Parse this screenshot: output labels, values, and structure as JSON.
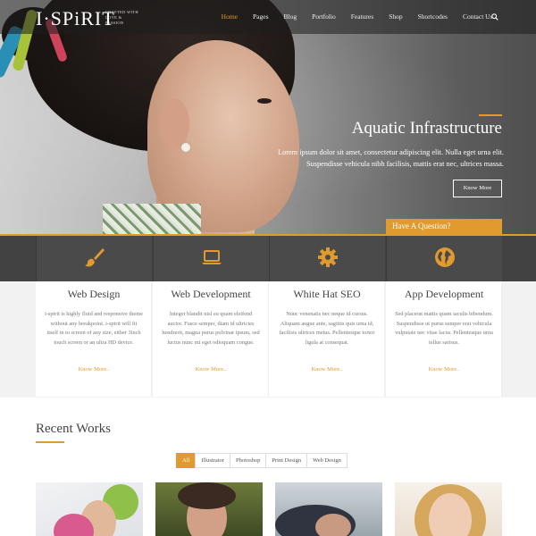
{
  "brand": {
    "logo_text": "I·SPiRIT",
    "tagline": "CRAFTED WITH LOVE & PASSION",
    "accent_color": "#e09a2e"
  },
  "nav": {
    "items": [
      "Home",
      "Pages",
      "Blog",
      "Portfolio",
      "Features",
      "Shop",
      "Shortcodes",
      "Contact Us"
    ],
    "active": "Home",
    "search_icon": "search-icon"
  },
  "hero": {
    "title": "Aquatic Infrastructure",
    "description": "Lorem ipsum dolor sit amet, consectetur adipiscing elit. Nulla eget urna elit. Suspendisse vehicula nibh facilisis, mattis erat nec, ultrices massa.",
    "button_label": "Know More"
  },
  "question_tab": {
    "label": "Have A Question?"
  },
  "services": [
    {
      "icon": "paintbrush-icon",
      "title": "Web Design",
      "description": "i-spirit is highly fluid and responsive theme without any breakpoint. i-spirit will fit itself in to screen of any size, either 3inch touch screen or an ultra HD device.",
      "link": "Know More.."
    },
    {
      "icon": "laptop-icon",
      "title": "Web Development",
      "description": "Integer blandit nisl eu quam eleifend auctor. Fusce semper, diam id ultricies hendrerit, magna purus pulvinar ipsum, sed luctus nunc mi eget odioquam congue.",
      "link": "Know More.."
    },
    {
      "icon": "gear-icon",
      "title": "White Hat SEO",
      "description": "Nunc venenatis nec neque id cursus. Aliquam augue ante, sagittis quis urna id, facilisis ultrices metus. Pellentesque tortor ligula at consequat.",
      "link": "Know More.."
    },
    {
      "icon": "globe-icon",
      "title": "App Development",
      "description": "Sed placerat mattis quam iaculis bibendum. Suspendisse ut purus semper erat vehicula vulputate nec vitae lacus. Pellentesque urna tellus sarisus.",
      "link": "Know More.."
    }
  ],
  "recent_works": {
    "title": "Recent Works",
    "filters": [
      "All",
      "Illustrator",
      "Photoshop",
      "Print Design",
      "Web Design"
    ],
    "active_filter": "All"
  }
}
